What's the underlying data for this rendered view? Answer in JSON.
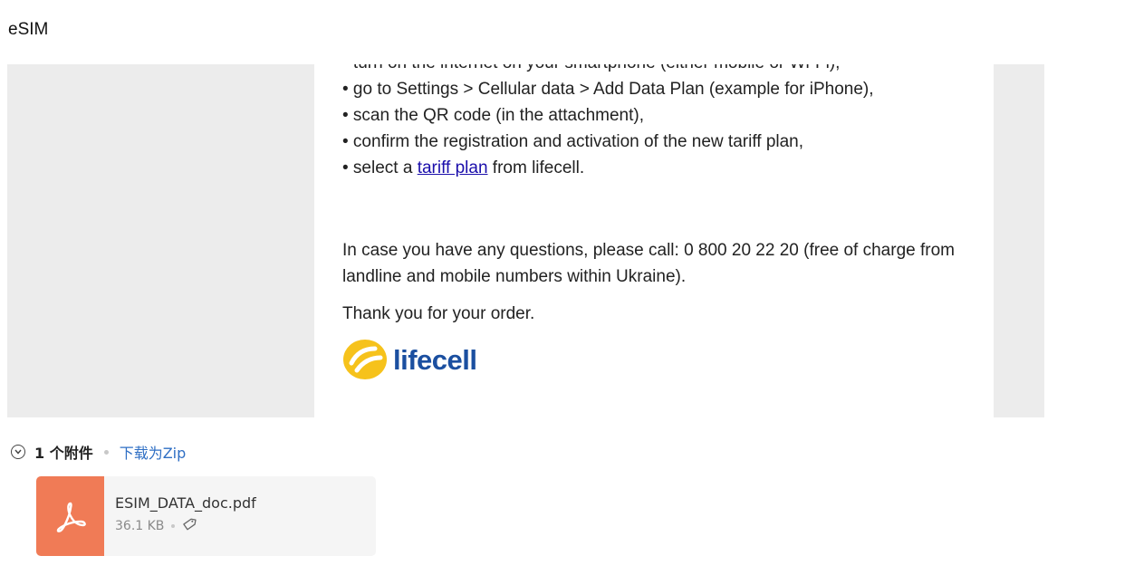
{
  "email": {
    "subject": "eSIM",
    "steps": [
      "• turn on the internet on your smartphone (either mobile or Wi-Fi),",
      "• go to Settings > Cellular data > Add Data Plan (example for iPhone),",
      "• scan the QR code (in the attachment),",
      "• confirm the registration and activation of the new tariff plan,"
    ],
    "last_step_prefix": "• select a ",
    "last_step_link": "tariff plan",
    "last_step_suffix": " from lifecell.",
    "support_text": "In case you have any questions, please call: 0 800 20 22 20 (free of charge from landline and mobile numbers within Ukraine).",
    "thanks_text": "Thank you for your order.",
    "logo_text": "lifecell",
    "logo_color": "#1b4fa0",
    "logo_mark_color": "#f6c21b"
  },
  "attachments": {
    "count_label": "1 个附件",
    "download_zip_label": "下载为Zip",
    "toggle_icon": "chevron-down-circle-icon",
    "files": [
      {
        "name": "ESIM_DATA_doc.pdf",
        "size": "36.1 KB",
        "type_icon": "pdf-icon",
        "tile_color": "#f07b56",
        "tag_icon": "tag-icon"
      }
    ]
  }
}
